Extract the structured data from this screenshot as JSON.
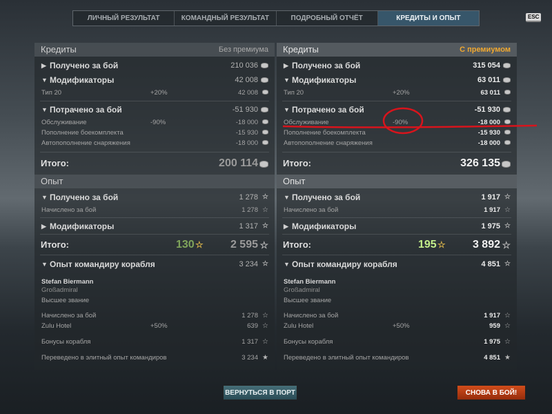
{
  "tabs": [
    "ЛИЧНЫЙ РЕЗУЛЬТАТ",
    "КОМАНДНЫЙ РЕЗУЛЬТАТ",
    "ПОДРОБНЫЙ ОТЧЁТ",
    "КРЕДИТЫ И ОПЫТ"
  ],
  "esc": "ESC",
  "left": {
    "credits": {
      "title": "Кредиты",
      "tag": "Без премиума",
      "earned_label": "Получено за бой",
      "earned": "210 036",
      "mod_label": "Модификаторы",
      "mod": "42 008",
      "tier_label": "Тип 20",
      "tier_pct": "+20%",
      "tier": "42 008",
      "spent_label": "Потрачено за бой",
      "spent": "-51 930",
      "service_label": "Обслуживание",
      "service_pct": "-90%",
      "service": "-18 000",
      "ammo_label": "Пополнение боекомплекта",
      "ammo": "-15 930",
      "supply_label": "Автопополнение снаряжения",
      "supply": "-18 000",
      "total_label": "Итого:",
      "total": "200 114"
    },
    "xp": {
      "title": "Опыт",
      "earned_label": "Получено за бой",
      "earned": "1 278",
      "acc_label": "Начислено за бой",
      "acc": "1 278",
      "mod_label": "Модификаторы",
      "mod": "1 317",
      "total_label": "Итого:",
      "free": "130",
      "total": "2 595"
    },
    "cmd": {
      "title": "Опыт командиру корабля",
      "value": "3 234",
      "name": "Stefan Biermann",
      "rank": "Großadmiral",
      "grade": "Высшее звание",
      "acc_label": "Начислено за бой",
      "acc": "1 278",
      "flag_label": "Zulu Hotel",
      "flag_pct": "+50%",
      "flag": "639",
      "bonus_label": "Бонусы корабля",
      "bonus": "1 317",
      "elite_label": "Переведено в элитный опыт командиров",
      "elite": "3 234"
    }
  },
  "right": {
    "credits": {
      "title": "Кредиты",
      "tag": "С премиумом",
      "earned_label": "Получено за бой",
      "earned": "315 054",
      "mod_label": "Модификаторы",
      "mod": "63 011",
      "tier_label": "Тип 20",
      "tier_pct": "+20%",
      "tier": "63 011",
      "spent_label": "Потрачено за бой",
      "spent": "-51 930",
      "service_label": "Обслуживание",
      "service_pct": "-90%",
      "service": "-18 000",
      "ammo_label": "Пополнение боекомплекта",
      "ammo": "-15 930",
      "supply_label": "Автопополнение снаряжения",
      "supply": "-18 000",
      "total_label": "Итого:",
      "total": "326 135"
    },
    "xp": {
      "title": "Опыт",
      "earned_label": "Получено за бой",
      "earned": "1 917",
      "acc_label": "Начислено за бой",
      "acc": "1 917",
      "mod_label": "Модификаторы",
      "mod": "1 975",
      "total_label": "Итого:",
      "free": "195",
      "total": "3 892"
    },
    "cmd": {
      "title": "Опыт командиру корабля",
      "value": "4 851",
      "name": "Stefan Biermann",
      "rank": "Großadmiral",
      "grade": "Высшее звание",
      "acc_label": "Начислено за бой",
      "acc": "1 917",
      "flag_label": "Zulu Hotel",
      "flag_pct": "+50%",
      "flag": "959",
      "bonus_label": "Бонусы корабля",
      "bonus": "1 975",
      "elite_label": "Переведено в элитный опыт командиров",
      "elite": "4 851"
    }
  },
  "buttons": {
    "port": "ВЕРНУТЬСЯ В ПОРТ",
    "battle": "СНОВА В БОЙ!"
  },
  "annotation_color": "#d8141c"
}
